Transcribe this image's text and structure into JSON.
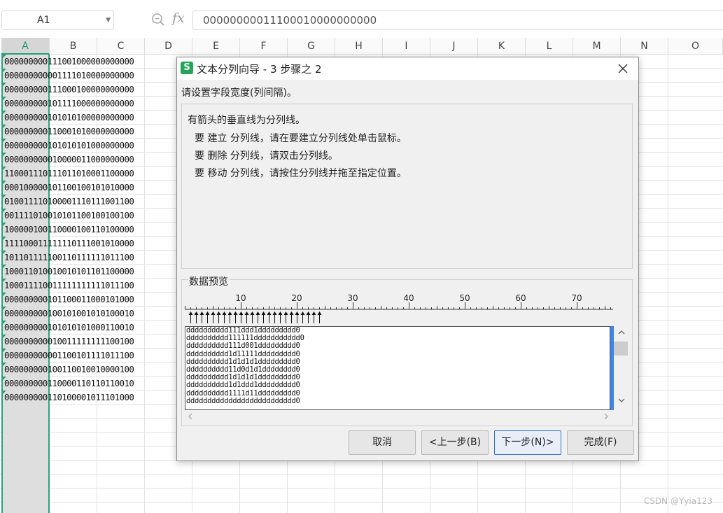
{
  "formula_bar": {
    "cell_ref": "A1",
    "fx": "fx",
    "value": "00000000011100010000000000"
  },
  "columns": [
    "A",
    "B",
    "C",
    "D",
    "E",
    "F",
    "G",
    "H",
    "I",
    "J",
    "K",
    "L",
    "M",
    "N",
    "O"
  ],
  "rows": [
    "000000000111001000000000000",
    "000000000001111010000000000",
    "000000000111000100000000000",
    "000000000101111000000000000",
    "000000000101010100000000000",
    "000000000110001010000000000",
    "000000000101010101000000000",
    "000000000010000011000000000",
    "110001110111011010001100000",
    "000100000101100100101010000",
    "010011110100001110111001100",
    "001111010010101100100100100",
    "100000100110000100110100000",
    "111100011111110111001010000",
    "101101111100110111111011100",
    "100011010010010101101100000",
    "100011110011111111111011100",
    "000000000101100011000101000",
    "000000000100101001010100010",
    "000000000101010101000110010",
    "000000000010011111111100100",
    "000000000001100101111011100",
    "000000000100110010010000100",
    "000000000110000110110110010",
    "000000000110100001011101000"
  ],
  "dialog": {
    "title": "文本分列向导 - 3 步骤之 2",
    "logo": "S",
    "instruction": "请设置字段宽度(列间隔)。",
    "info_lines": [
      "有箭头的垂直线为分列线。",
      "要 建立 分列线，请在要建立分列线处单击鼠标。",
      "要 删除 分列线，请双击分列线。",
      "要 移动 分列线，请按住分列线并拖至指定位置。"
    ],
    "preview_label": "数据预览",
    "ruler_labels": [
      "10",
      "20",
      "30",
      "40",
      "50",
      "60",
      "70"
    ],
    "preview_lines": [
      "dddddddddd111ddd1ddddddddd0",
      "dddddddddd111111ddddddddddd0",
      "dddddddddd111d001ddddddddd0",
      "dddddddddd1d11111ddddddddd0",
      "dddddddddd1d1d1d1ddddddddd0",
      "dddddddddd11d0d1d1dddddddd0",
      "dddddddddd1d1d1d1ddddddddd0",
      "dddddddddd1d1ddd1ddddddddd0",
      "dddddddddd1111d11ddddddddd0",
      "dddddddddddddddddddddddddd0"
    ],
    "buttons": {
      "cancel": "取消",
      "back": "<上一步(B)",
      "next": "下一步(N)>",
      "finish": "完成(F)"
    }
  },
  "watermark": "CSDN @Yyia123",
  "colors": {
    "selection_accent": "#2aa37c",
    "app_logo": "#23a55a",
    "primary_button_border": "#2e6fd6"
  }
}
